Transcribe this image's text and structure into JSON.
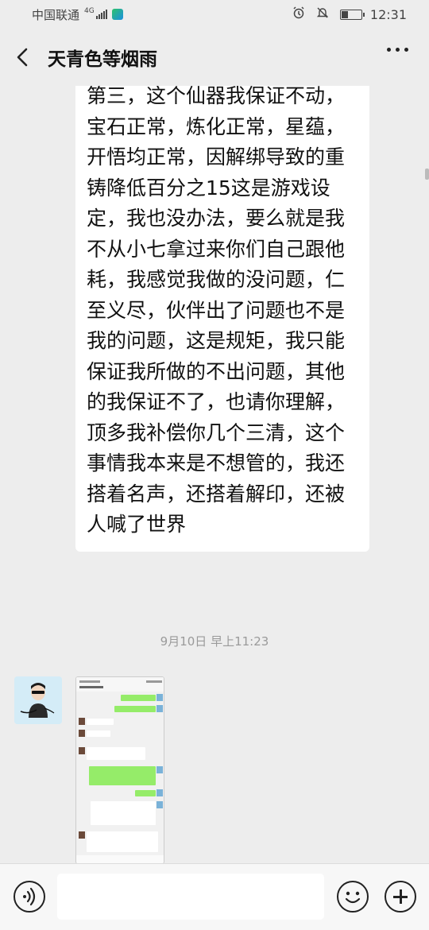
{
  "status_bar": {
    "carrier": "中国联通",
    "network": "4G",
    "time": "12:31",
    "icons": [
      "signal-icon",
      "app-icon",
      "alarm-icon",
      "mute-icon",
      "battery-icon"
    ]
  },
  "header": {
    "title": "天青色等烟雨",
    "back_icon": "chevron-left-icon",
    "more_icon": "more-dots-icon"
  },
  "messages": {
    "incoming_text": "第三，这个仙器我保证不动，宝石正常，炼化正常，星蕴，开悟均正常，因解绑导致的重铸降低百分之15这是游戏设定，我也没办法，要么就是我不从小七拿过来你们自己跟他耗，我感觉我做的没问题，仁至义尽，伙伴出了问题也不是我的问题，这是规矩，我只能保证我所做的不出问题，其他的我保证不了，也请你理解，顶多我补偿你几个三清，这个事情我本来是不想管的，我还搭着名声，还搭着解印，还被人喊了世界",
    "timestamp": "9月10日 早上11:23",
    "image_message": {
      "type": "screenshot-thumbnail"
    }
  },
  "input_bar": {
    "voice_icon": "voice-icon",
    "placeholder": "",
    "emoji_icon": "emoji-icon",
    "plus_icon": "plus-icon"
  },
  "colors": {
    "background": "#ededed",
    "bubble_in": "#ffffff",
    "bubble_out": "#95ec69",
    "timestamp": "#9a9a9a"
  }
}
